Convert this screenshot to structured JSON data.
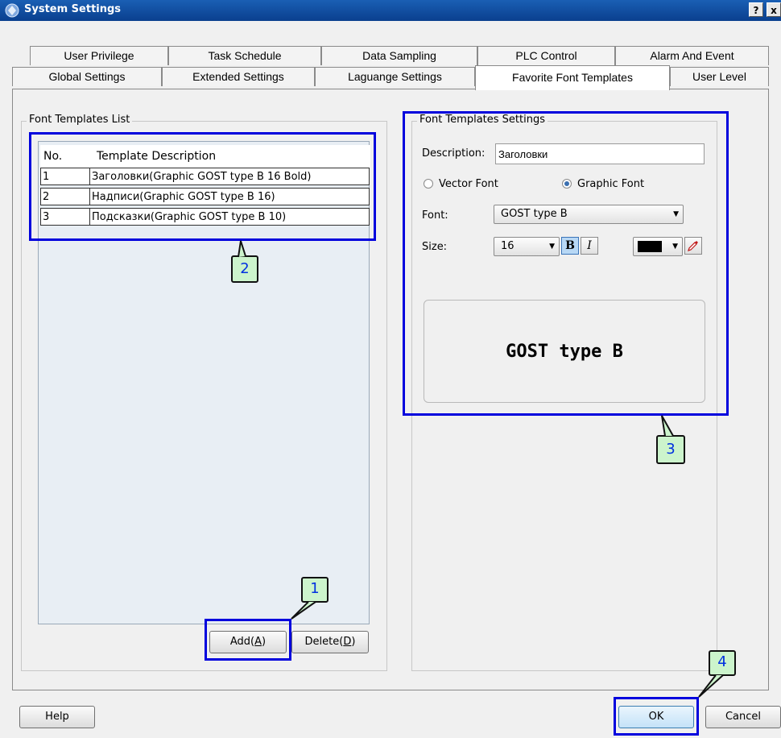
{
  "window": {
    "title": "System Settings",
    "help_glyph": "?",
    "close_glyph": "x",
    "app_icon": "vs-app-icon"
  },
  "tabs": {
    "row_back": [
      "User Privilege",
      "Task Schedule",
      "Data Sampling",
      "PLC Control",
      "Alarm And Event"
    ],
    "row_front": [
      "Global Settings",
      "Extended Settings",
      "Laguange Settings",
      "Favorite Font Templates",
      "User Level"
    ],
    "active": "Favorite Font Templates"
  },
  "font_list": {
    "group_label": "Font Templates List",
    "columns": [
      "No.",
      "Template Description"
    ],
    "rows": [
      {
        "no": "1",
        "desc": "Заголовки(Graphic GOST type B 16 Bold)"
      },
      {
        "no": "2",
        "desc": "Надписи(Graphic GOST type B 16)"
      },
      {
        "no": "3",
        "desc": "Подсказки(Graphic GOST type B 10)"
      }
    ],
    "add_label": "Add(",
    "add_hotkey": "A",
    "delete_label": "Delete(",
    "delete_hotkey": "D",
    "paren_close": ")"
  },
  "settings": {
    "group_label": "Font Templates Settings",
    "description_label": "Description:",
    "description_value": "Заголовки",
    "vector_font_label": "Vector Font",
    "graphic_font_label": "Graphic Font",
    "selected_font_type": "Graphic Font",
    "font_label": "Font:",
    "font_value": "GOST type B",
    "size_label": "Size:",
    "size_value": "16",
    "bold_glyph": "B",
    "italic_glyph": "I",
    "bold_on": true,
    "color": "#000000",
    "preview_text": "GOST type B"
  },
  "footer": {
    "help_label": "Help",
    "ok_label": "OK",
    "cancel_label": "Cancel"
  },
  "callouts": [
    "1",
    "2",
    "3",
    "4"
  ],
  "colors": {
    "title_bar": "#0a3f8e",
    "callout_border": "#0000dd",
    "badge_fill": "#ccf4cc",
    "badge_text": "#0030e0",
    "ok_highlight": "#d6ebfb"
  }
}
